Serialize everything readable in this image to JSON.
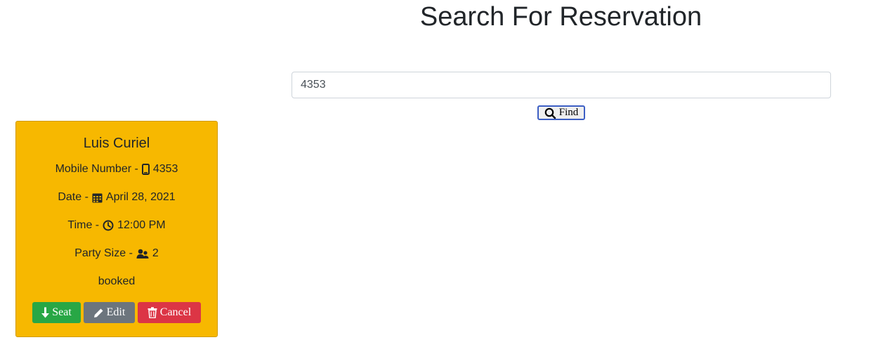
{
  "page": {
    "title": "Search For Reservation"
  },
  "search": {
    "value": "4353",
    "find_label": "Find"
  },
  "reservation": {
    "name": "Luis Curiel",
    "mobile_label": "Mobile Number -",
    "mobile_value": "4353",
    "date_label": "Date -",
    "date_value": "April 28, 2021",
    "time_label": "Time -",
    "time_value": "12:00 PM",
    "party_label": "Party Size -",
    "party_value": "2",
    "status": "booked",
    "card_color": "#f7b800",
    "actions": {
      "seat_label": "Seat",
      "edit_label": "Edit",
      "cancel_label": "Cancel"
    }
  },
  "icons": {
    "find": "search-icon",
    "mobile": "phone-icon",
    "date": "calendar-icon",
    "time": "clock-icon",
    "party": "people-icon",
    "seat": "arrow-down-icon",
    "edit": "pencil-icon",
    "cancel": "trash-icon"
  }
}
